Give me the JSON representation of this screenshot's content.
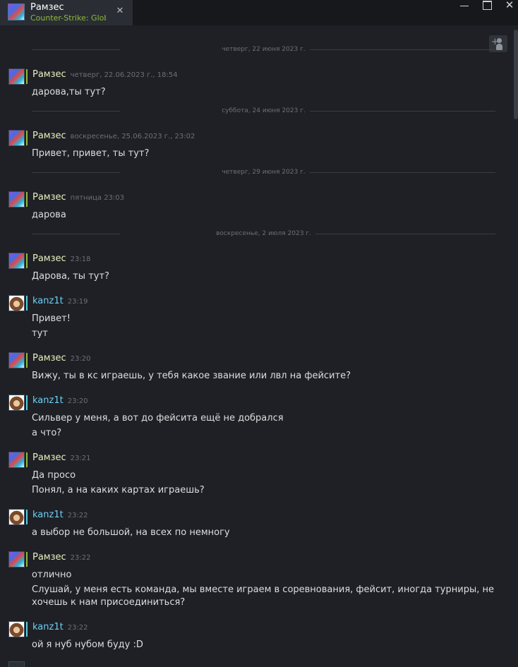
{
  "window": {
    "tab_name": "Рамзес",
    "tab_game": "Counter-Strike: Global Offensive",
    "close_glyph": "✕",
    "window_close_glyph": "✕",
    "icons": [
      "close-icon",
      "minimize-icon",
      "maximize-icon",
      "window-close-icon",
      "add-friend-icon"
    ]
  },
  "colors": {
    "in_game_name": "#e4f2bd",
    "online_name": "#6dcff6",
    "game_status": "#90ba3c",
    "text": "#dcdedf",
    "timestamp": "#6b7077"
  },
  "chat": {
    "dividers": [
      "четверг, 22 июня 2023 г.",
      "суббота, 24 июня 2023 г.",
      "четверг, 29 июня 2023 г.",
      "воскресенье, 2 июля 2023 г."
    ],
    "messages": [
      {
        "author": "Рамзес",
        "time": "четверг, 22.06.2023 г., 18:54",
        "lines": [
          "дарова,ты тут?"
        ]
      },
      {
        "author": "Рамзес",
        "time": "воскресенье, 25.06.2023 г., 23:02",
        "lines": [
          "Привет, привет, ты тут?"
        ]
      },
      {
        "author": "Рамзес",
        "time": "пятница 23:03",
        "lines": [
          "дарова"
        ]
      },
      {
        "author": "Рамзес",
        "time": "23:18",
        "lines": [
          "Дарова, ты тут?"
        ]
      },
      {
        "author": "kanz1t",
        "time": "23:19",
        "lines": [
          "Привет!",
          "тут"
        ]
      },
      {
        "author": "Рамзес",
        "time": "23:20",
        "lines": [
          "Вижу, ты в кс играешь, у тебя какое звание или лвл на фейсите?"
        ]
      },
      {
        "author": "kanz1t",
        "time": "23:20",
        "lines": [
          "Сильвер у меня, а вот до фейсита ещё не добрался",
          "а что?"
        ]
      },
      {
        "author": "Рамзес",
        "time": "23:21",
        "lines": [
          "Да просо",
          "Понял, а на каких картах играешь?"
        ]
      },
      {
        "author": "kanz1t",
        "time": "23:22",
        "lines": [
          "а выбор не большой, на всех по немногу"
        ]
      },
      {
        "author": "Рамзес",
        "time": "23:22",
        "lines": [
          "отлично",
          "Слушай, у меня есть команда, мы вместе играем в соревнования, фейсит, иногда турниры, не",
          "хочешь к нам присоединиться?"
        ]
      },
      {
        "author": "kanz1t",
        "time": "23:22",
        "lines": [
          "ой я нуб нубом буду :D"
        ]
      }
    ]
  }
}
